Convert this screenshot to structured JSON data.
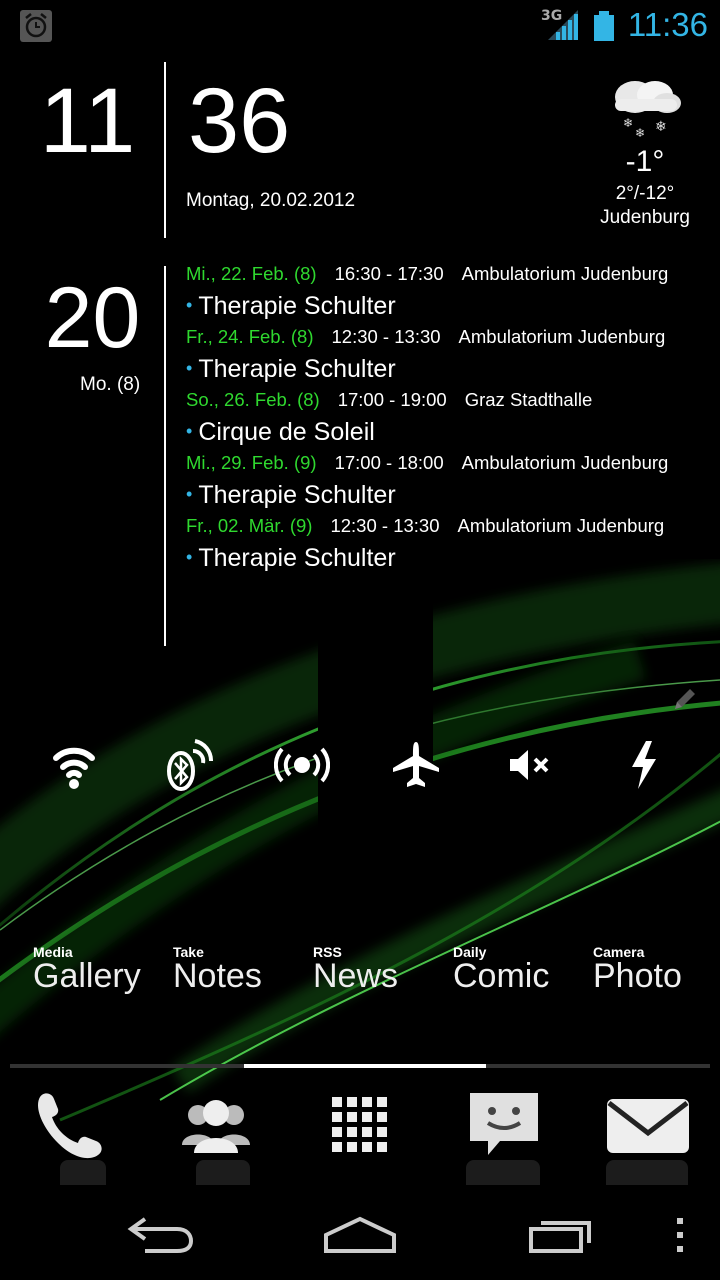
{
  "status_bar": {
    "alarm_icon": "alarm-clock-icon",
    "network_type": "3G",
    "signal_icon": "signal-bars-icon",
    "battery_icon": "battery-icon",
    "time": "11:36",
    "accent_color": "#33b5e5"
  },
  "clock": {
    "hour": "11",
    "minute": "36",
    "date": "Montag, 20.02.2012"
  },
  "weather": {
    "icon": "snow-cloud-icon",
    "temperature": "-1°",
    "range": "2°/-12°",
    "city": "Judenburg"
  },
  "calendar": {
    "day": "20",
    "weekday": "Mo. (8)",
    "date_color": "#2fd82f",
    "events": [
      {
        "date": "Mi., 22. Feb. (8)",
        "time": "16:30 - 17:30",
        "location": "Ambulatorium Judenburg",
        "title": "Therapie Schulter"
      },
      {
        "date": "Fr., 24. Feb. (8)",
        "time": "12:30 - 13:30",
        "location": "Ambulatorium Judenburg",
        "title": "Therapie Schulter"
      },
      {
        "date": "So., 26. Feb. (8)",
        "time": "17:00 - 19:00",
        "location": "Graz Stadthalle",
        "title": "Cirque de Soleil"
      },
      {
        "date": "Mi., 29. Feb. (9)",
        "time": "17:00 - 18:00",
        "location": "Ambulatorium Judenburg",
        "title": "Therapie Schulter"
      },
      {
        "date": "Fr., 02. Mär. (9)",
        "time": "12:30 - 13:30",
        "location": "Ambulatorium Judenburg",
        "title": "Therapie Schulter"
      }
    ]
  },
  "toggles": [
    {
      "name": "wifi-icon"
    },
    {
      "name": "bluetooth-icon"
    },
    {
      "name": "hotspot-icon"
    },
    {
      "name": "airplane-icon"
    },
    {
      "name": "mute-icon"
    },
    {
      "name": "flash-icon"
    }
  ],
  "edit_icon": "pencil-icon",
  "shortcuts": [
    {
      "small": "Media",
      "big": "Gallery"
    },
    {
      "small": "Take",
      "big": "Notes"
    },
    {
      "small": "RSS",
      "big": "News"
    },
    {
      "small": "Daily",
      "big": "Comic"
    },
    {
      "small": "Camera",
      "big": "Photo"
    }
  ],
  "dock": [
    "phone-icon",
    "contacts-icon",
    "app-drawer-icon",
    "messaging-icon",
    "email-icon"
  ],
  "nav": [
    "back-icon",
    "home-icon",
    "recent-apps-icon",
    "menu-icon"
  ]
}
